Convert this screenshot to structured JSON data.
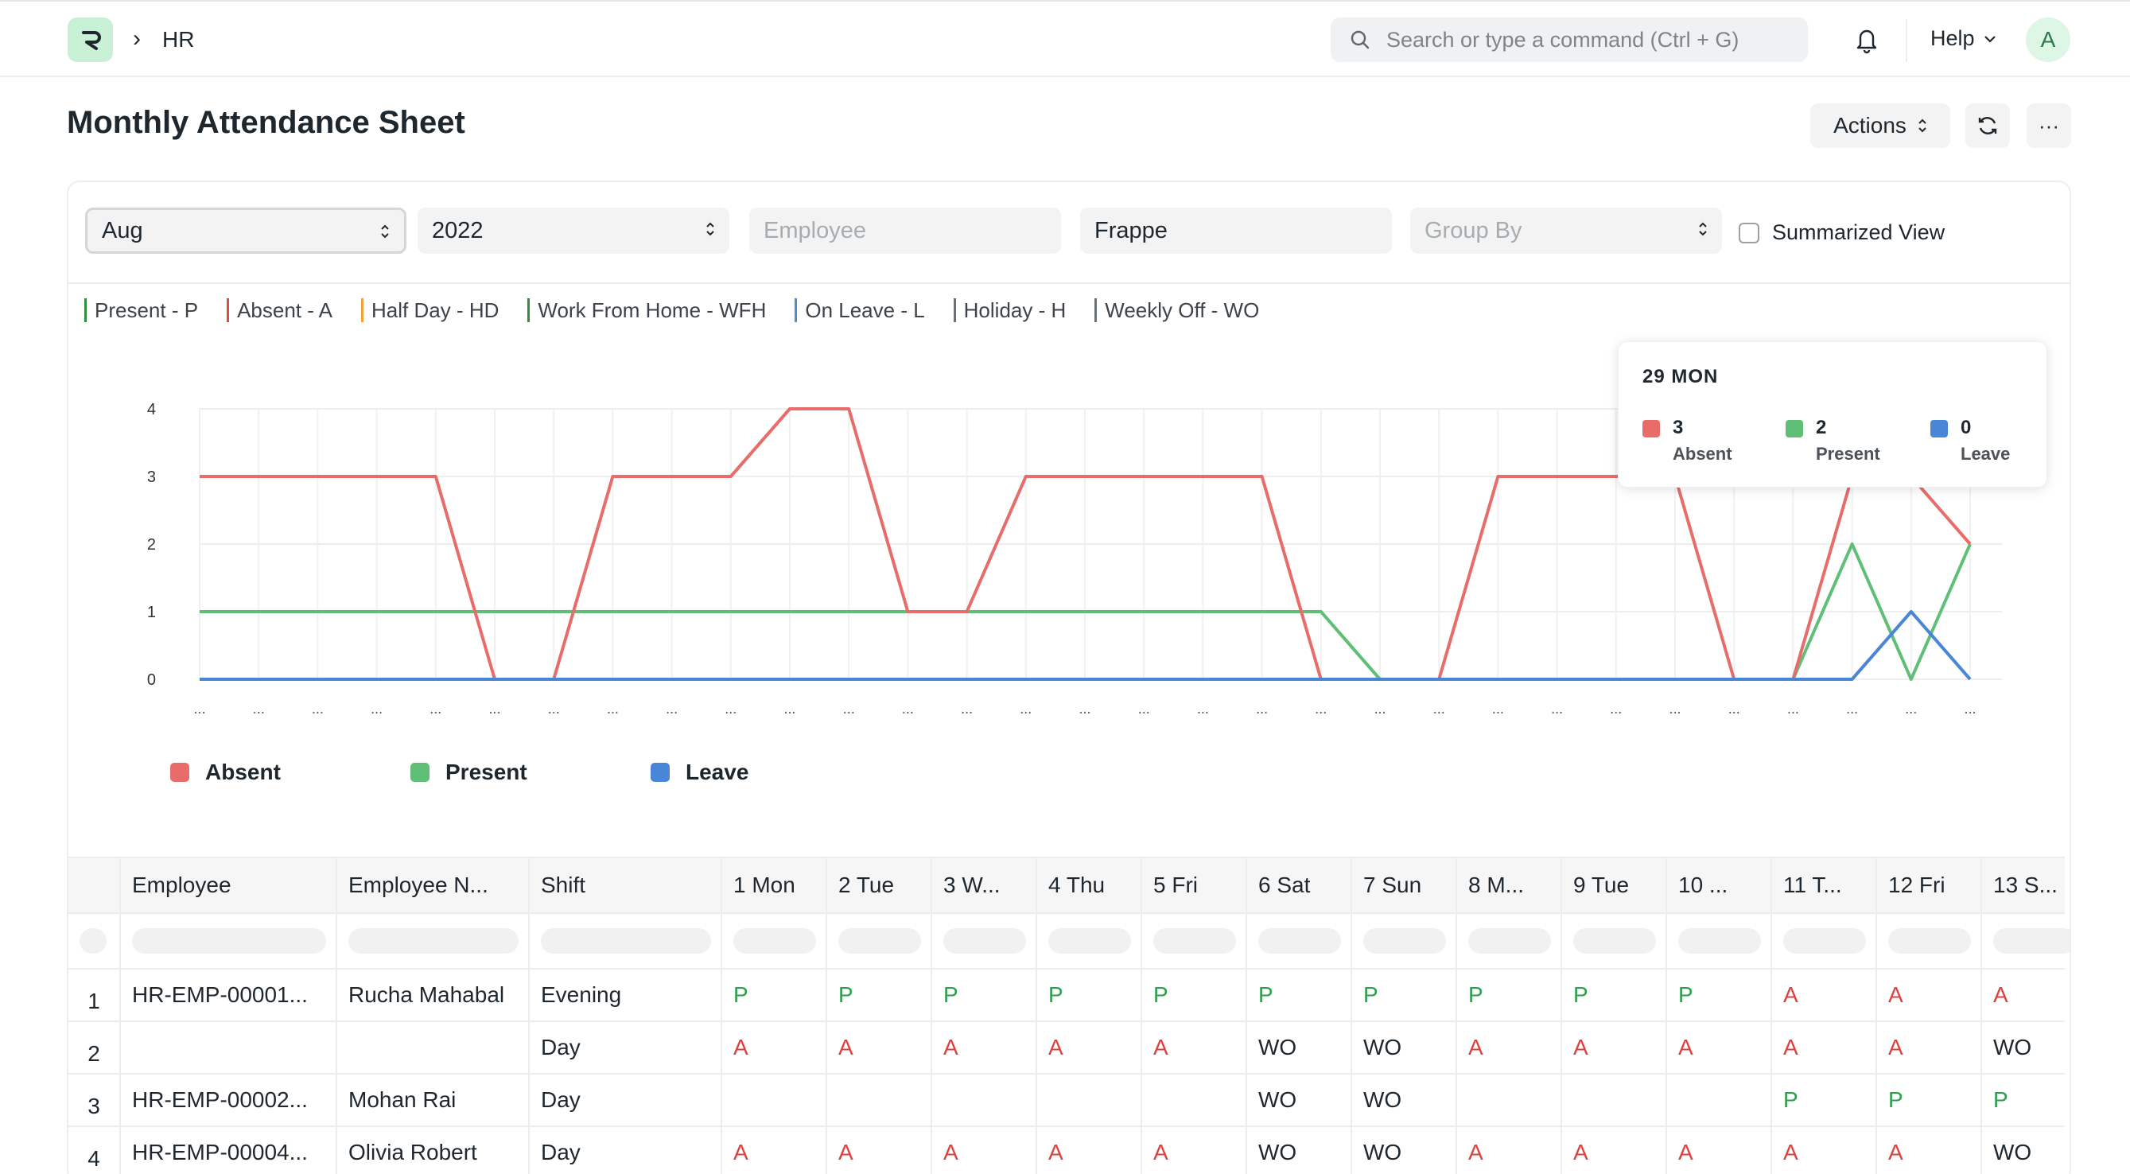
{
  "navbar": {
    "breadcrumb": "HR",
    "search_placeholder": "Search or type a command (Ctrl + G)",
    "help_label": "Help",
    "avatar_initial": "A"
  },
  "page": {
    "title": "Monthly Attendance Sheet",
    "actions_label": "Actions",
    "more_label": "···"
  },
  "filters": {
    "month": "Aug",
    "year": "2022",
    "employee_placeholder": "Employee",
    "company": "Frappe",
    "group_by_placeholder": "Group By",
    "summarized_view_label": "Summarized View"
  },
  "status_legend": [
    {
      "label": "Present - P",
      "color": "#2f8f3f"
    },
    {
      "label": "Absent - A",
      "color": "#e24c3c"
    },
    {
      "label": "Half Day - HD",
      "color": "#f0a23c"
    },
    {
      "label": "Work From Home - WFH",
      "color": "#2f8f3f"
    },
    {
      "label": "On Leave - L",
      "color": "#4c8fd8"
    },
    {
      "label": "Holiday - H",
      "color": "#6b7177"
    },
    {
      "label": "Weekly Off - WO",
      "color": "#6b7177"
    }
  ],
  "tooltip": {
    "title": "29 MON",
    "items": [
      {
        "value": "3",
        "label": "Absent",
        "color": "#e86c6a"
      },
      {
        "value": "2",
        "label": "Present",
        "color": "#5fbf77"
      },
      {
        "value": "0",
        "label": "Leave",
        "color": "#4a86d8"
      }
    ]
  },
  "chart_data": {
    "type": "line",
    "title": "",
    "xlabel": "",
    "ylabel": "",
    "x": [
      "...",
      "...",
      "...",
      "...",
      "...",
      "...",
      "...",
      "...",
      "...",
      "...",
      "...",
      "...",
      "...",
      "...",
      "...",
      "...",
      "...",
      "...",
      "...",
      "...",
      "...",
      "...",
      "...",
      "...",
      "...",
      "...",
      "...",
      "...",
      "...",
      "...",
      "..."
    ],
    "ylim": [
      0,
      4
    ],
    "yticks": [
      0,
      1,
      2,
      3,
      4
    ],
    "grid": true,
    "legend": "bottom-left",
    "series": [
      {
        "name": "Absent",
        "color": "#e86c6a",
        "values": [
          3,
          3,
          3,
          3,
          3,
          0,
          0,
          3,
          3,
          3,
          4,
          4,
          1,
          1,
          3,
          3,
          3,
          3,
          3,
          0,
          0,
          0,
          3,
          3,
          3,
          3,
          0,
          0,
          3,
          3,
          2
        ]
      },
      {
        "name": "Present",
        "color": "#5fbf77",
        "values": [
          1,
          1,
          1,
          1,
          1,
          1,
          1,
          1,
          1,
          1,
          1,
          1,
          1,
          1,
          1,
          1,
          1,
          1,
          1,
          1,
          0,
          0,
          0,
          0,
          0,
          0,
          0,
          0,
          2,
          0,
          2
        ]
      },
      {
        "name": "Leave",
        "color": "#4a86d8",
        "values": [
          0,
          0,
          0,
          0,
          0,
          0,
          0,
          0,
          0,
          0,
          0,
          0,
          0,
          0,
          0,
          0,
          0,
          0,
          0,
          0,
          0,
          0,
          0,
          0,
          0,
          0,
          0,
          0,
          0,
          1,
          0
        ]
      }
    ]
  },
  "table": {
    "columns": [
      "",
      "Employee",
      "Employee N...",
      "Shift",
      "1 Mon",
      "2 Tue",
      "3 W...",
      "4 Thu",
      "5 Fri",
      "6 Sat",
      "7 Sun",
      "8 M...",
      "9 Tue",
      "10 ...",
      "11 T...",
      "12 Fri",
      "13 S..."
    ],
    "rows": [
      [
        "1",
        "HR-EMP-00001...",
        "Rucha Mahabal",
        "Evening",
        "P",
        "P",
        "P",
        "P",
        "P",
        "P",
        "P",
        "P",
        "P",
        "P",
        "A",
        "A",
        "A"
      ],
      [
        "2",
        "",
        "",
        "Day",
        "A",
        "A",
        "A",
        "A",
        "A",
        "WO",
        "WO",
        "A",
        "A",
        "A",
        "A",
        "A",
        "WO"
      ],
      [
        "3",
        "HR-EMP-00002...",
        "Mohan Rai",
        "Day",
        "",
        "",
        "",
        "",
        "",
        "WO",
        "WO",
        "",
        "",
        "",
        "P",
        "P",
        "P"
      ],
      [
        "4",
        "HR-EMP-00004...",
        "Olivia Robert",
        "Day",
        "A",
        "A",
        "A",
        "A",
        "A",
        "WO",
        "WO",
        "A",
        "A",
        "A",
        "A",
        "A",
        "WO"
      ]
    ]
  }
}
